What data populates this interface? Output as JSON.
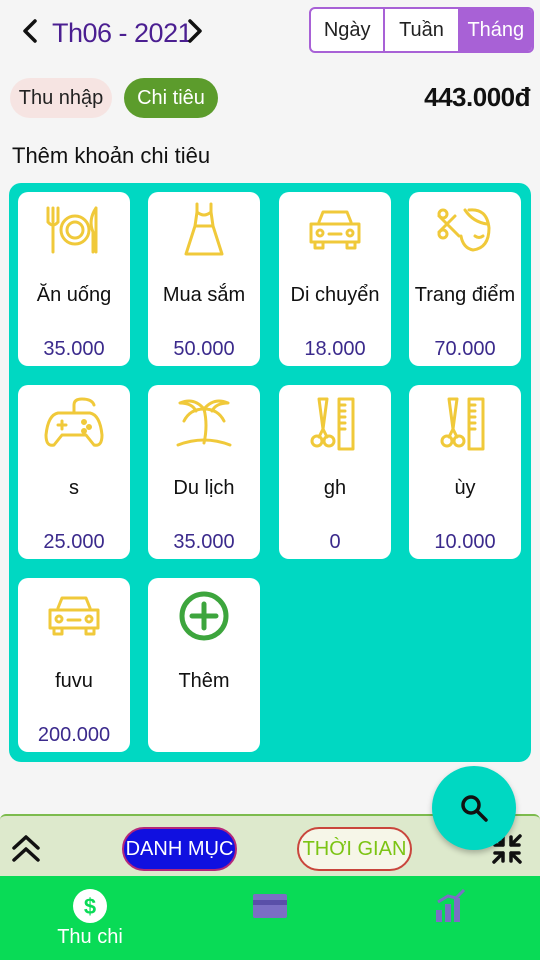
{
  "header": {
    "period": "Th06 - 2021",
    "view_modes": [
      "Ngày",
      "Tuần",
      "Tháng"
    ],
    "active_view": "Tháng"
  },
  "toggle": {
    "income_label": "Thu nhập",
    "expense_label": "Chi tiêu",
    "active": "Chi tiêu"
  },
  "total": "443.000đ",
  "section_title": "Thêm khoản chi tiêu",
  "categories": [
    {
      "name": "Ăn uống",
      "amount": "35.000",
      "icon": "fork-plate-knife-icon"
    },
    {
      "name": "Mua sắm",
      "amount": "50.000",
      "icon": "dress-icon"
    },
    {
      "name": "Di chuyển",
      "amount": "18.000",
      "icon": "car-icon"
    },
    {
      "name": "Trang điểm",
      "amount": "70.000",
      "icon": "makeup-face-icon"
    },
    {
      "name": "s",
      "amount": "25.000",
      "icon": "gamepad-icon"
    },
    {
      "name": "Du lịch",
      "amount": "35.000",
      "icon": "palm-tree-icon"
    },
    {
      "name": "gh",
      "amount": "0",
      "icon": "scissors-comb-icon"
    },
    {
      "name": "ùy",
      "amount": "10.000",
      "icon": "scissors-comb-icon"
    },
    {
      "name": "fuvu",
      "amount": "200.000",
      "icon": "car-icon"
    }
  ],
  "add_card": {
    "label": "Thêm",
    "icon": "plus-circle-icon"
  },
  "filter_bar": {
    "category_label": "DANH MỤC",
    "time_label": "THỜI GIAN"
  },
  "bottom_nav": {
    "tabs": [
      {
        "label": "Thu chi",
        "icon": "dollar-circle-icon"
      },
      {
        "label": "",
        "icon": "card-icon"
      },
      {
        "label": "",
        "icon": "stats-icon"
      }
    ]
  },
  "colors": {
    "accent_purple": "#a861d6",
    "panel_teal": "#00d8c2",
    "icon_yellow": "#f0c93a",
    "nav_green": "#09db56",
    "expense_green": "#5c9c2c",
    "amount_purple": "#3b2a8c"
  }
}
